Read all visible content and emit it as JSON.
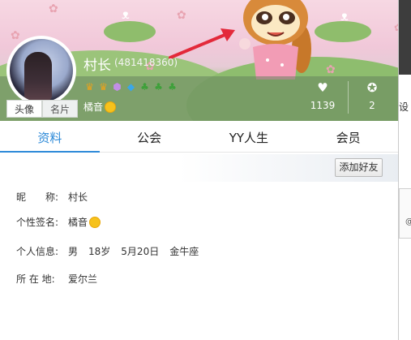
{
  "profile": {
    "nickname": "村长",
    "yy_id": "(481418360)",
    "signature": "橘音",
    "avatar_tabs": [
      "头像",
      "名片"
    ],
    "badges": [
      "crown-icon",
      "crown-icon",
      "shield-icon",
      "gem-icon",
      "leaf-icon",
      "leaf-icon",
      "leaf-icon"
    ],
    "stats": {
      "likes": "1139",
      "medals": "2"
    }
  },
  "tabs": [
    {
      "label": "资料",
      "active": true
    },
    {
      "label": "公会",
      "active": false
    },
    {
      "label": "YY人生",
      "active": false
    },
    {
      "label": "会员",
      "active": false
    }
  ],
  "actions": {
    "add_friend_label": "添加好友"
  },
  "info": {
    "nickname_label": "昵　　称:",
    "nickname_value": "村长",
    "signature_label": "个性签名:",
    "signature_value": "橘音",
    "personal_label": "个人信息:",
    "gender": "男",
    "age": "18岁",
    "birthday": "5月20日",
    "zodiac": "金牛座",
    "location_label": "所 在 地:",
    "location_value": "爱尔兰"
  },
  "side": {
    "partial_label": "设",
    "partial_glyph": "@"
  },
  "colors": {
    "accent": "#2d8ad8",
    "arrow": "#e3293a"
  }
}
